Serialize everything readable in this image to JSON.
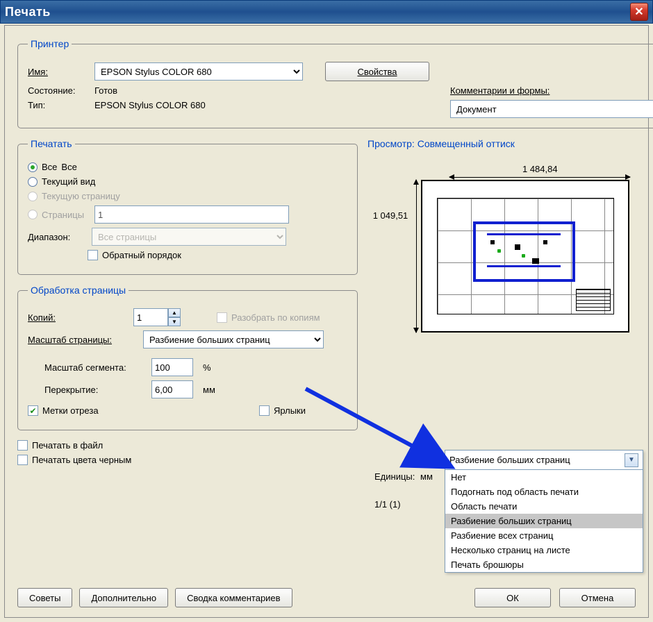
{
  "window": {
    "title": "Печать"
  },
  "printer": {
    "legend": "Принтер",
    "name_label": "Имя:",
    "name_value": "EPSON Stylus COLOR 680",
    "properties_btn": "Свойства",
    "status_label": "Состояние:",
    "status_value": "Готов",
    "type_label": "Тип:",
    "type_value": "EPSON Stylus COLOR 680",
    "comments_label": "Комментарии и формы:",
    "comments_value": "Документ"
  },
  "range": {
    "legend": "Печатать",
    "all": "Все",
    "current_view": "Текущий вид",
    "current_page": "Текущую страницу",
    "pages": "Страницы",
    "pages_value": "1",
    "subset_label": "Диапазон:",
    "subset_value": "Все страницы",
    "reverse": "Обратный порядок"
  },
  "handling": {
    "legend": "Обработка страницы",
    "copies_label": "Копий:",
    "copies_value": "1",
    "collate": "Разобрать по копиям",
    "scale_label": "Масштаб страницы:",
    "scale_value": "Разбиение больших страниц",
    "segment_label": "Масштаб сегмента:",
    "segment_value": "100",
    "segment_unit": "%",
    "overlap_label": "Перекрытие:",
    "overlap_value": "6,00",
    "overlap_unit": "мм",
    "cut_marks": "Метки отреза",
    "labels": "Ярлыки"
  },
  "misc": {
    "print_to_file": "Печатать в файл",
    "print_black": "Печатать цвета черным"
  },
  "preview": {
    "title": "Просмотр: Совмещенный оттиск",
    "width": "1 484,84",
    "height": "1 049,51",
    "units_label": "Единицы:",
    "units_value": "мм",
    "pages": "1/1 (1)"
  },
  "popup": {
    "selected": "Разбиение больших страниц",
    "options": [
      "Нет",
      "Подогнать под область печати",
      "Область печати",
      "Разбиение больших страниц",
      "Разбиение всех страниц",
      "Несколько страниц на листе",
      "Печать брошюры"
    ]
  },
  "buttons": {
    "tips": "Советы",
    "advanced": "Дополнительно",
    "summary": "Сводка комментариев",
    "ok": "ОК",
    "cancel": "Отмена"
  }
}
